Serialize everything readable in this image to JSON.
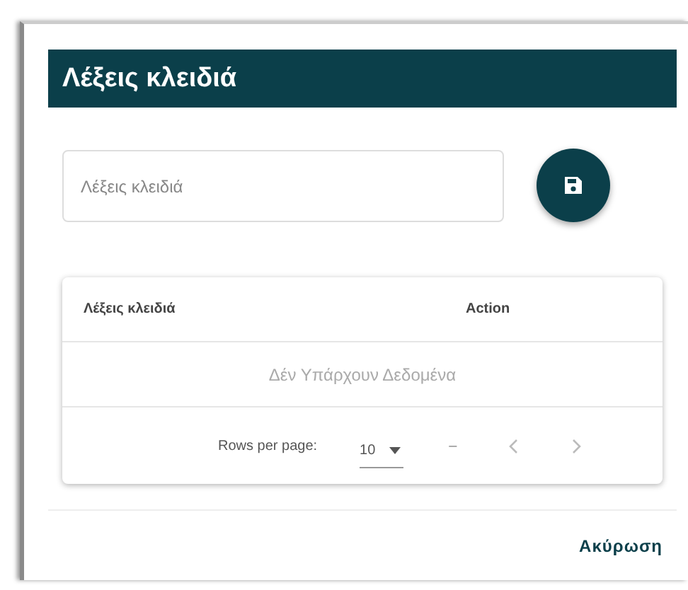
{
  "dialog": {
    "title": "Λέξεις κλειδιά",
    "field": {
      "placeholder": "Λέξεις κλειδιά"
    },
    "table": {
      "columns": [
        "Λέξεις κλειδιά",
        "Action"
      ],
      "empty_message": "Δέν Υπάρχουν Δεδομένα",
      "footer": {
        "rows_per_page_label": "Rows per page:",
        "rows_per_page": "10",
        "range": "–"
      }
    },
    "buttons": [
      "Ακύρωση"
    ]
  }
}
